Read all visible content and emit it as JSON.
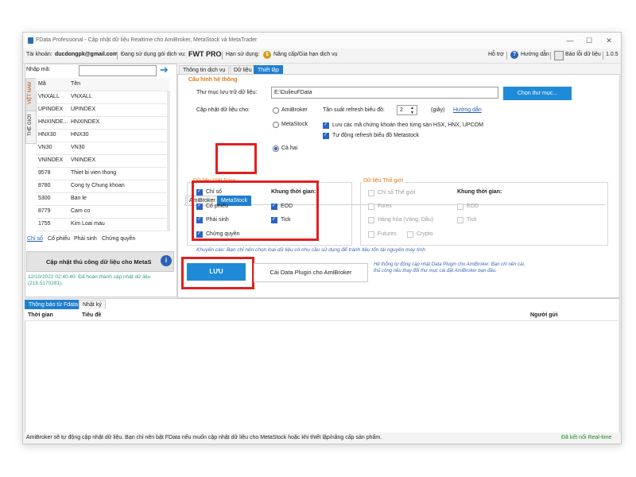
{
  "window": {
    "title": "FData Professional - Cập nhật dữ liệu Realtime cho AmiBroker, MetaStock và MetaTrader",
    "controls": [
      "—",
      "☐",
      "✕"
    ]
  },
  "account_bar": {
    "account_label": "Tài khoản:",
    "account_value": "ducdongpk@gmail.com",
    "package_label": "Đang sử dụng gói dịch vụ:",
    "package_value": "FWT PRO",
    "expiry_label": "Hạn sử dụng:",
    "upgrade_label": "Nâng cấp/Gia hạn dịch vụ",
    "support_label": "Hỗ trợ",
    "guide_label": "Hướng dẫn",
    "report_label": "Báo lỗi dữ liệu",
    "version": "1.0.5"
  },
  "left": {
    "search_label": "Nhập mã:",
    "search_value": "",
    "side_tabs": [
      "VIỆT NAM",
      "THẾ GIỚI"
    ],
    "columns": [
      "Mã",
      "Tên"
    ],
    "rows": [
      {
        "code": "VNXALL",
        "name": "VNXALL"
      },
      {
        "code": "UPINDEX",
        "name": "UPINDEX"
      },
      {
        "code": "HNXINDE...",
        "name": "HNXINDEX"
      },
      {
        "code": "HNX30",
        "name": "HNX30"
      },
      {
        "code": "VN30",
        "name": "VN30"
      },
      {
        "code": "VNINDEX",
        "name": "VNINDEX"
      },
      {
        "code": "9578",
        "name": "Thiet bi vien thong"
      },
      {
        "code": "8780",
        "name": "Cong ty Chung khoan"
      },
      {
        "code": "5300",
        "name": "Ban le"
      },
      {
        "code": "8779",
        "name": "Cam co"
      },
      {
        "code": "1755",
        "name": "Kim Loai mau"
      }
    ],
    "filters": [
      "Chỉ số",
      "Cổ phiếu",
      "Phái sinh",
      "Chứng quyền"
    ],
    "update_button": "Cập nhật thủ công dữ liệu cho MetaS",
    "update_status": "12/10/2022 02:40:40: Đã hoàn thành cập nhật dữ liệu (218.5170281)."
  },
  "tabs": [
    "Thông tin dịch vụ",
    "Dữ liệu",
    "Thiết lập"
  ],
  "settings": {
    "section_title": "Cấu hình hệ thống",
    "folder_label": "Thư mục lưu trữ dữ liệu:",
    "folder_value": "E:\\DulieuFData",
    "choose_folder_button": "Chọn thư mục...",
    "update_for_label": "Cập nhật dữ liệu cho:",
    "radio_options": [
      "AmiBroker",
      "MetaStock",
      "Cả hai"
    ],
    "refresh_label": "Tần suất refresh biểu đồ:",
    "refresh_value": "2",
    "refresh_unit": "(giây)",
    "refresh_guide": "Hướng dẫn",
    "option_save_by_exchange": "Lưu các mã chứng khoán theo từng sàn HSX, HNX, UPCOM",
    "option_auto_refresh": "Tự động refresh biểu đồ Metastock",
    "sub_tabs": [
      "AmiBroker",
      "MetaStock"
    ],
    "vn_title": "Dữ liệu Việt Nam",
    "vn_items": [
      "Chỉ số",
      "Cổ phiếu",
      "Phái sinh",
      "Chứng quyền"
    ],
    "timeframe_label": "Khung thời gian:",
    "vn_timeframes": [
      "EOD",
      "Tick"
    ],
    "world_title": "Dữ liệu Thế giới",
    "world_items": [
      "Chỉ số Thế giới",
      "Forex",
      "Hàng hóa (Vàng, Dầu)",
      "Futures",
      "Crypto"
    ],
    "world_timeframe_label": "Khung thời gian:",
    "world_timeframes": [
      "EOD",
      "Tick"
    ],
    "recommend_text": "Khuyến cáo: Bạn chỉ nên chọn loại dữ liệu có nhu cầu sử dụng để tránh tiêu tốn tài nguyên máy tính",
    "save_button": "LƯU",
    "install_plugin_button": "Cài Data Plugin cho AmiBroker",
    "plugin_note_1": "Hệ thống tự động cập nhật Data Plugin cho AmiBroker. Bạn chỉ nên cài,",
    "plugin_note_2": "thủ công nếu thay đổi thư mục cài đặt AmiBroker bạn đầu."
  },
  "bottom": {
    "tabs": [
      "Thông báo từ Fdata",
      "Nhật ký"
    ],
    "columns": [
      "Thời gian",
      "Tiêu đề",
      "Người gửi"
    ]
  },
  "status_bar": {
    "message": "AmiBroker sẽ tự động cập nhật dữ liệu. Bạn chỉ nên bật FData nếu muốn cập nhật dữ liệu cho MetaStock hoặc khi thiết lập/nâng cấp sản phẩm.",
    "connection": "Đã kết nối Real-time"
  },
  "colors": {
    "accent": "#1f7fcf",
    "highlight": "#e02020",
    "section_title": "#e07a14"
  }
}
